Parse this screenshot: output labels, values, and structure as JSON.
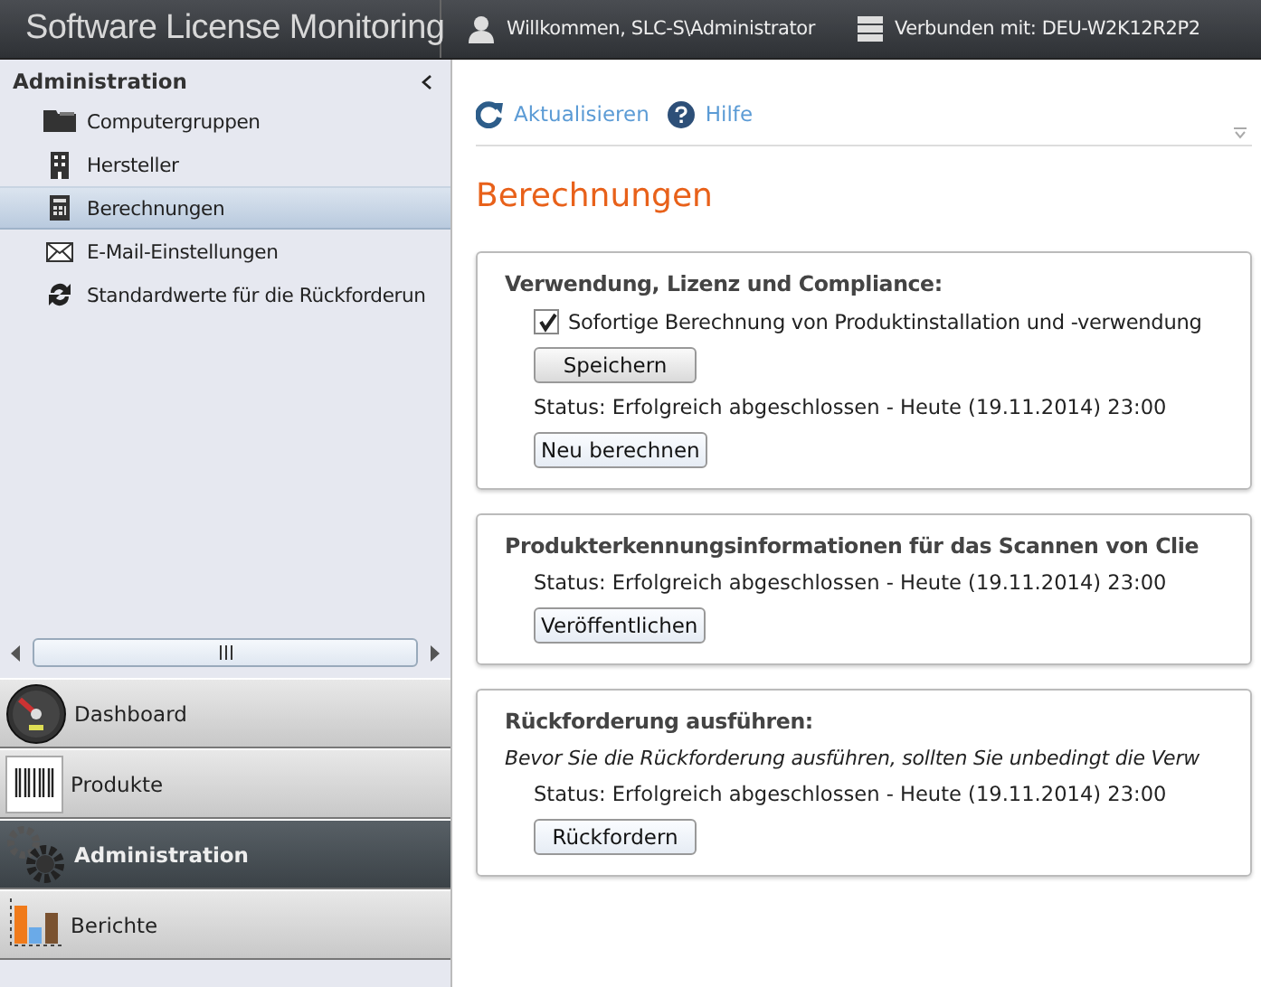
{
  "header": {
    "title": "Software License Monitoring",
    "user": "Willkommen, SLC-S\\Administrator",
    "connection": "Verbunden mit: DEU-W2K12R2P2"
  },
  "sidebar": {
    "title": "Administration",
    "items": [
      {
        "label": "Computergruppen",
        "kind": "folder",
        "selected": false
      },
      {
        "label": "Hersteller",
        "kind": "building",
        "selected": false
      },
      {
        "label": "Berechnungen",
        "kind": "calculator",
        "selected": true
      },
      {
        "label": "E-Mail-Einstellungen",
        "kind": "mail",
        "selected": false
      },
      {
        "label": "Standardwerte für die Rückforderun",
        "kind": "cycle",
        "selected": false
      }
    ]
  },
  "nav": [
    {
      "label": "Dashboard",
      "kind": "gauge",
      "selected": false
    },
    {
      "label": "Produkte",
      "kind": "barcode",
      "selected": false
    },
    {
      "label": "Administration",
      "kind": "gears",
      "selected": true
    },
    {
      "label": "Berichte",
      "kind": "chart",
      "selected": false
    }
  ],
  "toolbar": [
    {
      "label": "Aktualisieren",
      "kind": "refresh"
    },
    {
      "label": "Hilfe",
      "kind": "help"
    }
  ],
  "page_title": "Berechnungen",
  "sections": [
    {
      "title": "Verwendung, Lizenz und Compliance:",
      "checkbox": {
        "label": "Sofortige Berechnung von Produktinstallation und -verwendung",
        "checked": true
      },
      "save_button": "Speichern",
      "status": "Status:  Erfolgreich abgeschlossen - Heute (19.11.2014) 23:00",
      "button": "Neu berechnen"
    },
    {
      "title": "Produkterkennungsinformationen für das Scannen von Clie",
      "status": "Status:  Erfolgreich abgeschlossen - Heute (19.11.2014) 23:00",
      "button": "Veröffentlichen"
    },
    {
      "title": "Rückforderung ausführen:",
      "note": "Bevor Sie die Rückforderung ausführen, sollten Sie unbedingt die Verw",
      "status": "Status:  Erfolgreich abgeschlossen - Heute (19.11.2014) 23:00",
      "button": "Rückfordern"
    }
  ]
}
